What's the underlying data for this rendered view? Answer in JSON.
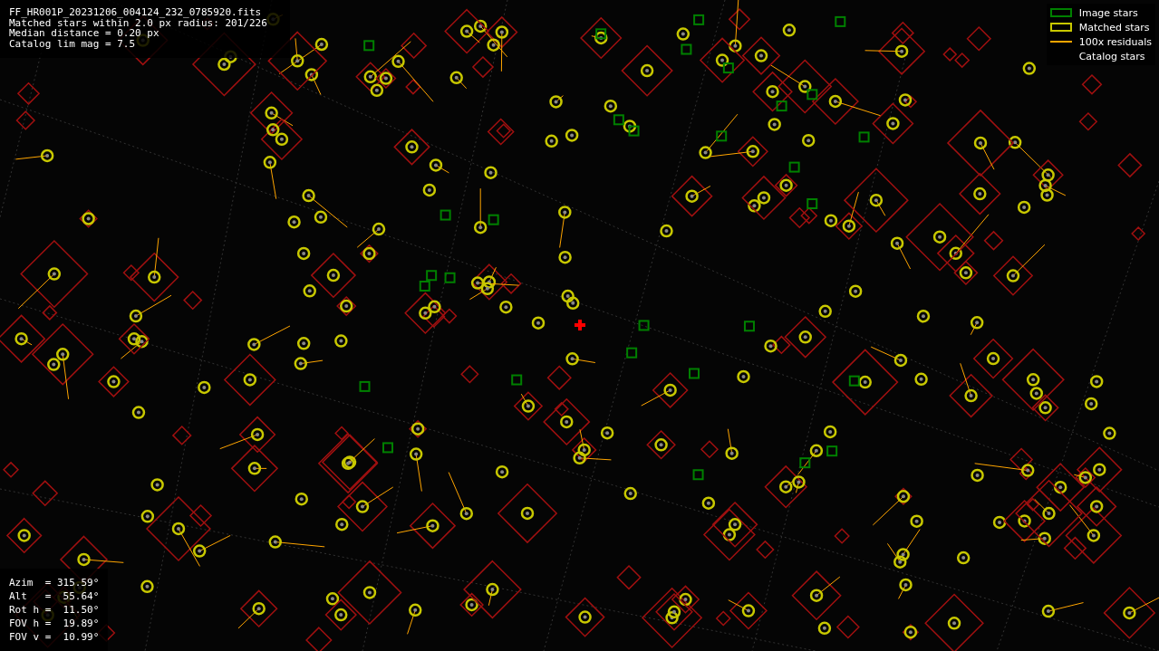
{
  "info_lines": [
    "FF_HR001P_20231206_004124_232_0785920.fits",
    "Matched stars within 2.0 px radius: 201/226",
    "Median distance = 0.20 px",
    "Catalog lim mag = 7.5"
  ],
  "legend": [
    {
      "kind": "box",
      "label": "Image stars",
      "color": "#008000"
    },
    {
      "kind": "box",
      "label": "Matched stars",
      "color": "#c8c800"
    },
    {
      "kind": "line",
      "label": "100x residuals",
      "color": "#ffa500"
    },
    {
      "kind": "none",
      "label": "Catalog stars"
    }
  ],
  "pointing": [
    "Azim  = 315.59°",
    "Alt   =  55.64°",
    "Rot h =  11.50°",
    "FOV h =  19.89°",
    "FOV v =  10.99°"
  ]
}
